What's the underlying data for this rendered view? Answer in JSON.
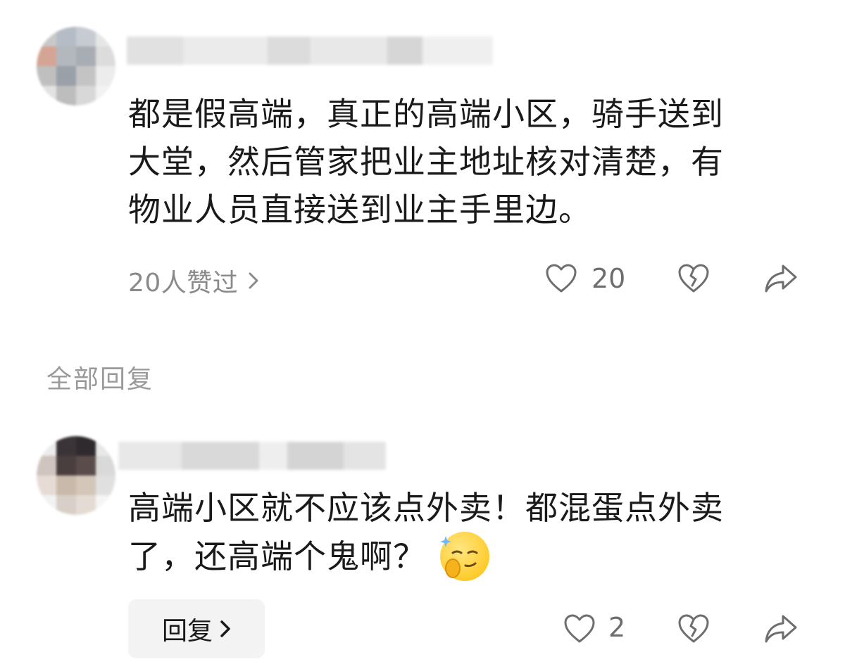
{
  "comments": [
    {
      "text_lines": [
        "都是假高端，真正的高端小区，骑手送到",
        "大堂，然后管家把业主地址核对清楚，有",
        "物业人员直接送到业主手里边。"
      ],
      "likers_label": "20人赞过",
      "like_count": "20",
      "icons": {
        "like": "heart-icon",
        "dislike": "broken-heart-icon",
        "share": "share-icon",
        "chevron": "chevron-right-icon"
      }
    },
    {
      "text_lines": [
        "高端小区就不应该点外卖！都混蛋点外卖",
        "了，还高端个鬼啊？"
      ],
      "emoji": "smug-thinking-emoji",
      "reply_label": "回复",
      "like_count": "2",
      "icons": {
        "like": "heart-icon",
        "dislike": "broken-heart-icon",
        "share": "share-icon",
        "chevron": "chevron-right-icon"
      }
    }
  ],
  "section_title": "全部回复",
  "colors": {
    "text": "#1a1a1a",
    "muted": "#8a8a8a",
    "reply_bg": "#f3f3f3",
    "icon": "#6e6e6e"
  }
}
